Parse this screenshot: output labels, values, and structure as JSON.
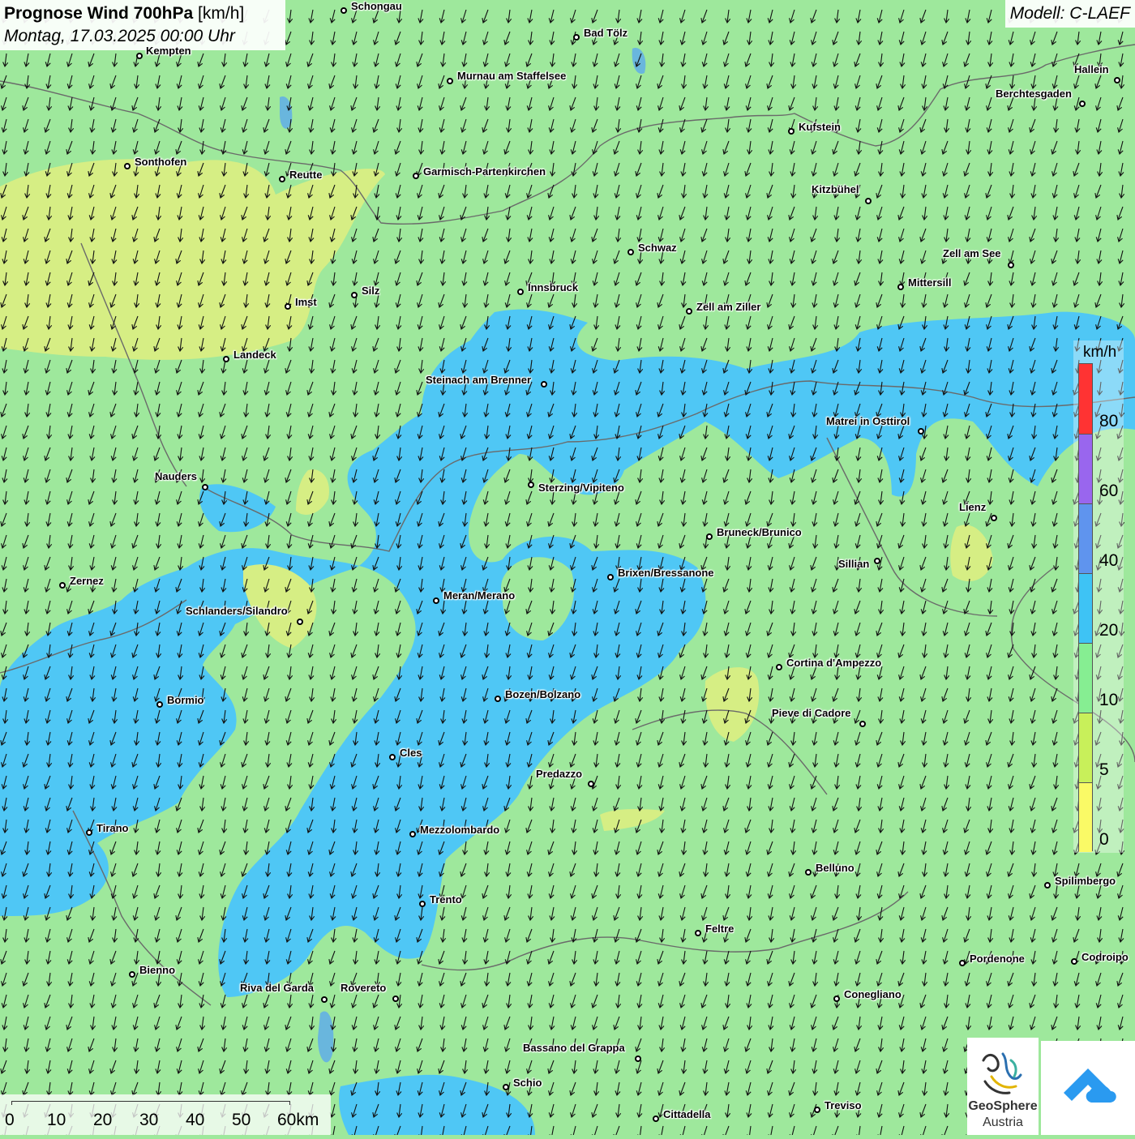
{
  "title": {
    "main": "Prognose Wind 700hPa",
    "unit": "[km/h]",
    "date": "Montag, 17.03.2025 00:00 Uhr"
  },
  "model": "Modell: C-LAEF",
  "legend": {
    "unit": "km/h",
    "labels": [
      "80",
      "60",
      "40",
      "20",
      "10",
      "5",
      "0"
    ],
    "bands": [
      {
        "color": "#ff3333"
      },
      {
        "color": "#9966ee"
      },
      {
        "color": "#5f94ee"
      },
      {
        "color": "#3ec3f5"
      },
      {
        "color": "#86ee92"
      },
      {
        "color": "#c8f05a"
      },
      {
        "color": "#fafa66"
      }
    ]
  },
  "scale": {
    "labels": [
      "0",
      "10",
      "20",
      "30",
      "40",
      "50",
      "60km"
    ]
  },
  "logos": {
    "geosphere_line1": "GeoSphere",
    "geosphere_line2": "Austria"
  },
  "cities": [
    {
      "name": "Schongau"
    },
    {
      "name": "Kempten"
    },
    {
      "name": "Bad Tölz"
    },
    {
      "name": "Murnau am Staffelsee"
    },
    {
      "name": "Hallein"
    },
    {
      "name": "Berchtesgaden"
    },
    {
      "name": "Kufstein"
    },
    {
      "name": "Sonthofen"
    },
    {
      "name": "Reutte"
    },
    {
      "name": "Garmisch-Partenkirchen"
    },
    {
      "name": "Kitzbühel"
    },
    {
      "name": "Schwaz"
    },
    {
      "name": "Zell am See"
    },
    {
      "name": "Innsbruck"
    },
    {
      "name": "Mittersill"
    },
    {
      "name": "Silz"
    },
    {
      "name": "Imst"
    },
    {
      "name": "Zell am Ziller"
    },
    {
      "name": "Landeck"
    },
    {
      "name": "Steinach am Brenner"
    },
    {
      "name": "Matrei in Osttirol"
    },
    {
      "name": "Nauders"
    },
    {
      "name": "Sterzing/Vipiteno"
    },
    {
      "name": "Lienz"
    },
    {
      "name": "Bruneck/Brunico"
    },
    {
      "name": "Sillian"
    },
    {
      "name": "Zernez"
    },
    {
      "name": "Brixen/Bressanone"
    },
    {
      "name": "Meran/Merano"
    },
    {
      "name": "Schlanders/Silandro"
    },
    {
      "name": "Cortina d'Ampezzo"
    },
    {
      "name": "Bozen/Bolzano"
    },
    {
      "name": "Bormio"
    },
    {
      "name": "Pieve di Cadore"
    },
    {
      "name": "Cles"
    },
    {
      "name": "Predazzo"
    },
    {
      "name": "Tirano"
    },
    {
      "name": "Mezzolombardo"
    },
    {
      "name": "Belluno"
    },
    {
      "name": "Spilimbergo"
    },
    {
      "name": "Trento"
    },
    {
      "name": "Feltre"
    },
    {
      "name": "Bienno"
    },
    {
      "name": "Pordenone"
    },
    {
      "name": "Codroipo"
    },
    {
      "name": "Riva del Garda"
    },
    {
      "name": "Rovereto"
    },
    {
      "name": "Conegliano"
    },
    {
      "name": "Bassano del Grappa"
    },
    {
      "name": "Schio"
    },
    {
      "name": "Treviso"
    },
    {
      "name": "Cittadella"
    }
  ]
}
